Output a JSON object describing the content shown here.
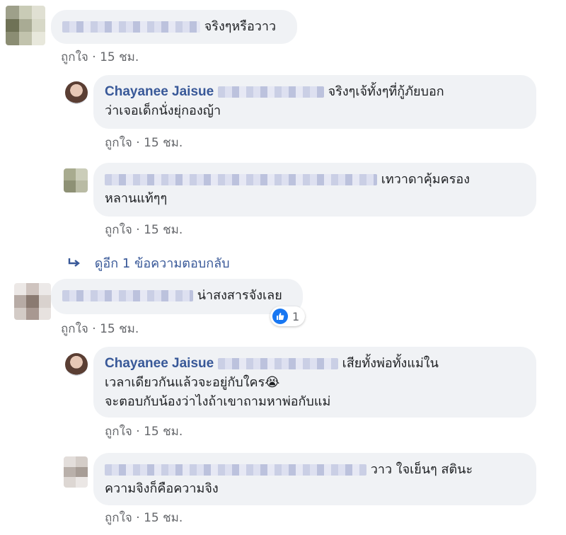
{
  "comments": [
    {
      "text": "จริงๆหรือวาว",
      "meta_like": "ถูกใจ",
      "meta_sep": "·",
      "meta_time": "15 ชม."
    },
    {
      "author": "Chayanee Jaisue",
      "text_line1": "จริงๆเจ้ทั้งๆที่กู้ภัยบอก",
      "text_line2": "ว่าเจอเด็กนั่งยุ่กองญ้า",
      "meta_like": "ถูกใจ",
      "meta_sep": "·",
      "meta_time": "15 ชม."
    },
    {
      "text_line1": "เทวาดาคุ้มครอง",
      "text_line2": "หลานแท้ๆๆ",
      "meta_like": "ถูกใจ",
      "meta_sep": "·",
      "meta_time": "15 ชม."
    },
    {
      "text": "น่าสงสารจังเลย",
      "reaction_count": "1",
      "meta_like": "ถูกใจ",
      "meta_sep": "·",
      "meta_time": "15 ชม."
    },
    {
      "author": "Chayanee Jaisue",
      "text_line1": "เสียทั้งพ่อทั้งแม่ใน",
      "text_line2": "เวลาเดียวกันแล้วจะอยู่กับใคร😭",
      "text_line3": "จะตอบกับน้องว่าไงถ้าเขาถามหาพ่อกับแม่",
      "meta_like": "ถูกใจ",
      "meta_sep": "·",
      "meta_time": "15 ชม."
    },
    {
      "text_line1": "วาว ใจเย็นๆ สตินะ",
      "text_line2": "ความจิงก็คือความจิง",
      "meta_like": "ถูกใจ",
      "meta_sep": "·",
      "meta_time": "15 ชม."
    }
  ],
  "more_replies": {
    "icon": "reply-arrow-icon",
    "label": "ดูอีก 1 ข้อความตอบกลับ"
  },
  "colors": {
    "bubble": "#f0f2f5",
    "name": "#385898",
    "meta": "#65676b",
    "like_blue": "#1877f2"
  }
}
